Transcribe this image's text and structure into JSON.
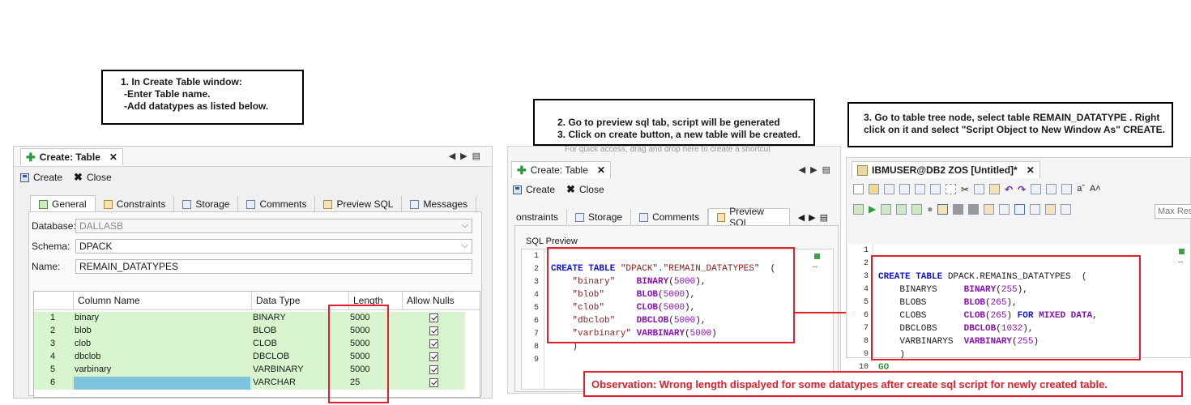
{
  "callouts": {
    "step1": [
      "1. In Create Table window:",
      "-Enter Table name.",
      "-Add datatypes as listed below."
    ],
    "step2": [
      "2. Go to preview sql tab, script will be generated",
      "3. Click on create button, a new table will be created."
    ],
    "step3": [
      "3. Go to table tree node, select table REMAIN_DATATYPE . Right",
      "click on it and select \"Script Object to New Window As\" CREATE."
    ],
    "observation": "Observation: Wrong length dispalyed  for some datatypes after create sql script for newly created table."
  },
  "left_panel": {
    "tab_title": "Create: Table",
    "toolbar": {
      "create": "Create",
      "close": "Close"
    },
    "tabs": [
      "General",
      "Constraints",
      "Storage",
      "Comments",
      "Preview SQL",
      "Messages"
    ],
    "form": {
      "database_label": "Database:",
      "database_value": "DALLASB",
      "schema_label": "Schema:",
      "schema_value": "DPACK",
      "name_label": "Name:",
      "name_value": "REMAIN_DATATYPES"
    },
    "grid": {
      "headers": [
        "Column Name",
        "Data Type",
        "Length",
        "Allow Nulls"
      ],
      "rows": [
        {
          "n": "1",
          "name": "binary",
          "type": "BINARY",
          "len": "5000"
        },
        {
          "n": "2",
          "name": "blob",
          "type": "BLOB",
          "len": "5000"
        },
        {
          "n": "3",
          "name": "clob",
          "type": "CLOB",
          "len": "5000"
        },
        {
          "n": "4",
          "name": "dbclob",
          "type": "DBCLOB",
          "len": "5000"
        },
        {
          "n": "5",
          "name": "varbinary",
          "type": "VARBINARY",
          "len": "5000"
        },
        {
          "n": "6",
          "name": "",
          "type": "VARCHAR",
          "len": "25"
        }
      ]
    }
  },
  "middle_panel": {
    "behind_text": "For quick access, drag and drop here to create a shortcut",
    "tab_title": "Create: Table",
    "toolbar": {
      "create": "Create",
      "close": "Close"
    },
    "tabs": [
      "onstraints",
      "Storage",
      "Comments",
      "Preview SQL"
    ],
    "section_label": "SQL Preview",
    "line_numbers": [
      "1",
      "2",
      "3",
      "4",
      "5",
      "6",
      "7",
      "8",
      "9"
    ]
  },
  "right_panel": {
    "tab_title": "IBMUSER@DB2 ZOS [Untitled]*",
    "search_placeholder": "Max Resu",
    "line_numbers": [
      "1",
      "2",
      "3",
      "4",
      "5",
      "6",
      "7",
      "8",
      "9",
      "10"
    ]
  }
}
